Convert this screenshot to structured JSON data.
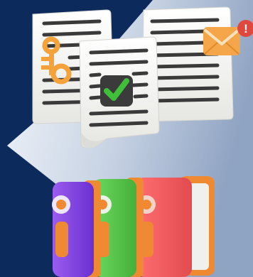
{
  "scene": {
    "colors": {
      "background": "#0d2a5c",
      "panel_gradient_start": "#f3f6fb",
      "panel_gradient_end": "#8fa3c2",
      "paper": "#f2f2ef",
      "paper_lines": "#3a3a3a",
      "key": "#f5a23a",
      "envelope": "#f5a64a",
      "envelope_badge": "#e0483e",
      "check_badge": "#3b3b3b",
      "check_mark": "#3fbf3a",
      "binder_purple": "#7e3fe0",
      "binder_green": "#58c64a",
      "binder_red": "#ef5a5d",
      "binder_orange": "#f08a32",
      "binder_ring": "#f0f0ee"
    },
    "badge_text": "!"
  }
}
